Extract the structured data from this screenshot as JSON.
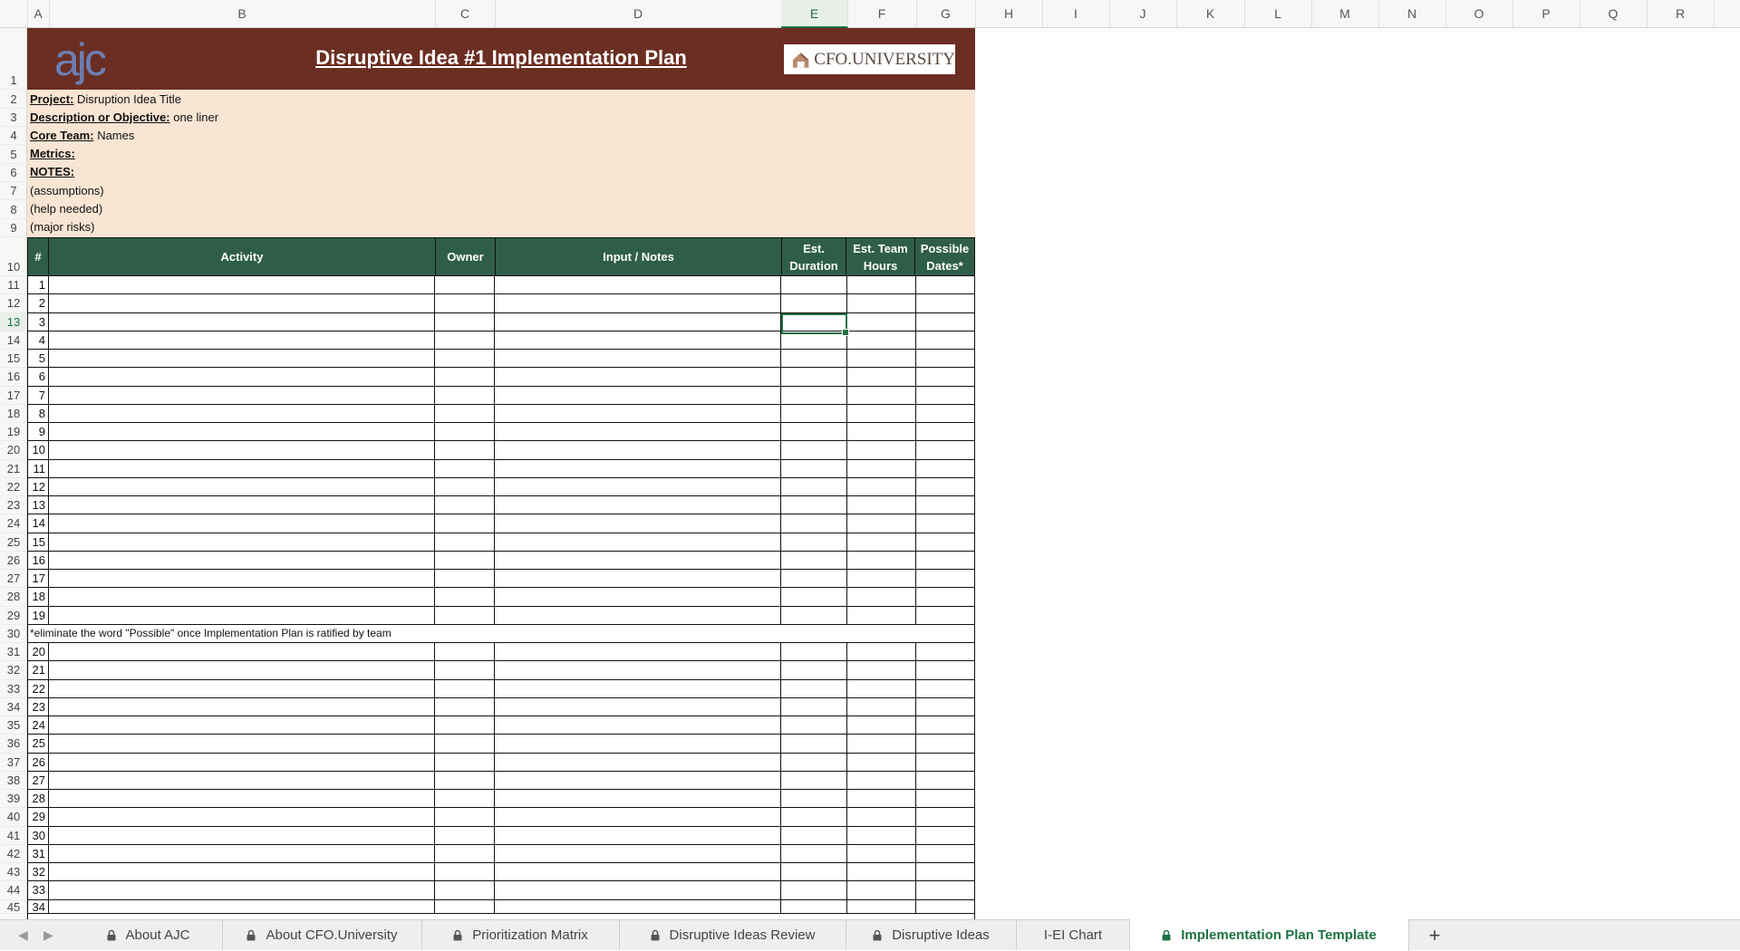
{
  "columns": [
    {
      "label": "A"
    },
    {
      "label": "B"
    },
    {
      "label": "C"
    },
    {
      "label": "D"
    },
    {
      "label": "E"
    },
    {
      "label": "F"
    },
    {
      "label": "G"
    },
    {
      "label": "H"
    },
    {
      "label": "I"
    },
    {
      "label": "J"
    },
    {
      "label": "K"
    },
    {
      "label": "L"
    },
    {
      "label": "M"
    },
    {
      "label": "N"
    },
    {
      "label": "O"
    },
    {
      "label": "P"
    },
    {
      "label": "Q"
    },
    {
      "label": "R"
    }
  ],
  "active_column": "E",
  "active_row": "13",
  "banner": {
    "logo_left": "ajc",
    "title": "Disruptive Idea #1 Implementation Plan",
    "logo_right": "CFO.UNIVERSITY"
  },
  "info": {
    "project_label": "Project:",
    "project_value": "Disruption Idea Title",
    "description_label": "Description or Objective:",
    "description_value": "one liner",
    "core_team_label": "Core Team:",
    "core_team_value": "Names",
    "metrics_label": "Metrics:",
    "notes_label": "NOTES:",
    "note1": "(assumptions)",
    "note2": "(help needed)",
    "note3": "(major risks)"
  },
  "table": {
    "headers": {
      "num": "#",
      "activity": "Activity",
      "owner": "Owner",
      "notes": "Input / Notes",
      "duration": "Est. Duration",
      "hours": "Est. Team Hours",
      "dates": "Possible Dates*"
    },
    "footnote": "*eliminate the word \"Possible\" once Implementation Plan is ratified by team"
  },
  "rows": [
    {
      "row": "1",
      "num": ""
    },
    {
      "row": "2",
      "num": ""
    },
    {
      "row": "3",
      "num": ""
    },
    {
      "row": "4",
      "num": ""
    },
    {
      "row": "5",
      "num": ""
    },
    {
      "row": "6",
      "num": ""
    },
    {
      "row": "7",
      "num": ""
    },
    {
      "row": "8",
      "num": ""
    },
    {
      "row": "9",
      "num": ""
    },
    {
      "row": "10",
      "num": ""
    },
    {
      "row": "11",
      "num": "1"
    },
    {
      "row": "12",
      "num": "2"
    },
    {
      "row": "13",
      "num": "3"
    },
    {
      "row": "14",
      "num": "4"
    },
    {
      "row": "15",
      "num": "5"
    },
    {
      "row": "16",
      "num": "6"
    },
    {
      "row": "17",
      "num": "7"
    },
    {
      "row": "18",
      "num": "8"
    },
    {
      "row": "19",
      "num": "9"
    },
    {
      "row": "20",
      "num": "10"
    },
    {
      "row": "21",
      "num": "11"
    },
    {
      "row": "22",
      "num": "12"
    },
    {
      "row": "23",
      "num": "13"
    },
    {
      "row": "24",
      "num": "14"
    },
    {
      "row": "25",
      "num": "15"
    },
    {
      "row": "26",
      "num": "16"
    },
    {
      "row": "27",
      "num": "17"
    },
    {
      "row": "28",
      "num": "18"
    },
    {
      "row": "29",
      "num": "19"
    },
    {
      "row": "30",
      "num": ""
    },
    {
      "row": "31",
      "num": "20"
    },
    {
      "row": "32",
      "num": "21"
    },
    {
      "row": "33",
      "num": "22"
    },
    {
      "row": "34",
      "num": "23"
    },
    {
      "row": "35",
      "num": "24"
    },
    {
      "row": "36",
      "num": "25"
    },
    {
      "row": "37",
      "num": "26"
    },
    {
      "row": "38",
      "num": "27"
    },
    {
      "row": "39",
      "num": "28"
    },
    {
      "row": "40",
      "num": "29"
    },
    {
      "row": "41",
      "num": "30"
    },
    {
      "row": "42",
      "num": "31"
    },
    {
      "row": "43",
      "num": "32"
    },
    {
      "row": "44",
      "num": "33"
    },
    {
      "row": "45",
      "num": "34"
    }
  ],
  "sheet_tabs": [
    {
      "label": "About AJC",
      "locked": true,
      "active": false
    },
    {
      "label": "About CFO.University",
      "locked": true,
      "active": false
    },
    {
      "label": "Prioritization Matrix",
      "locked": true,
      "active": false
    },
    {
      "label": "Disruptive Ideas Review",
      "locked": true,
      "active": false
    },
    {
      "label": "Disruptive Ideas",
      "locked": true,
      "active": false
    },
    {
      "label": "I-EI Chart",
      "locked": false,
      "active": false
    },
    {
      "label": "Implementation Plan Template",
      "locked": true,
      "active": true
    }
  ],
  "add_sheet_label": "+",
  "colors": {
    "banner": "#6b2e22",
    "info_bg": "#f9e5d4",
    "header_green": "#2f5e48",
    "accent": "#1e7145"
  }
}
